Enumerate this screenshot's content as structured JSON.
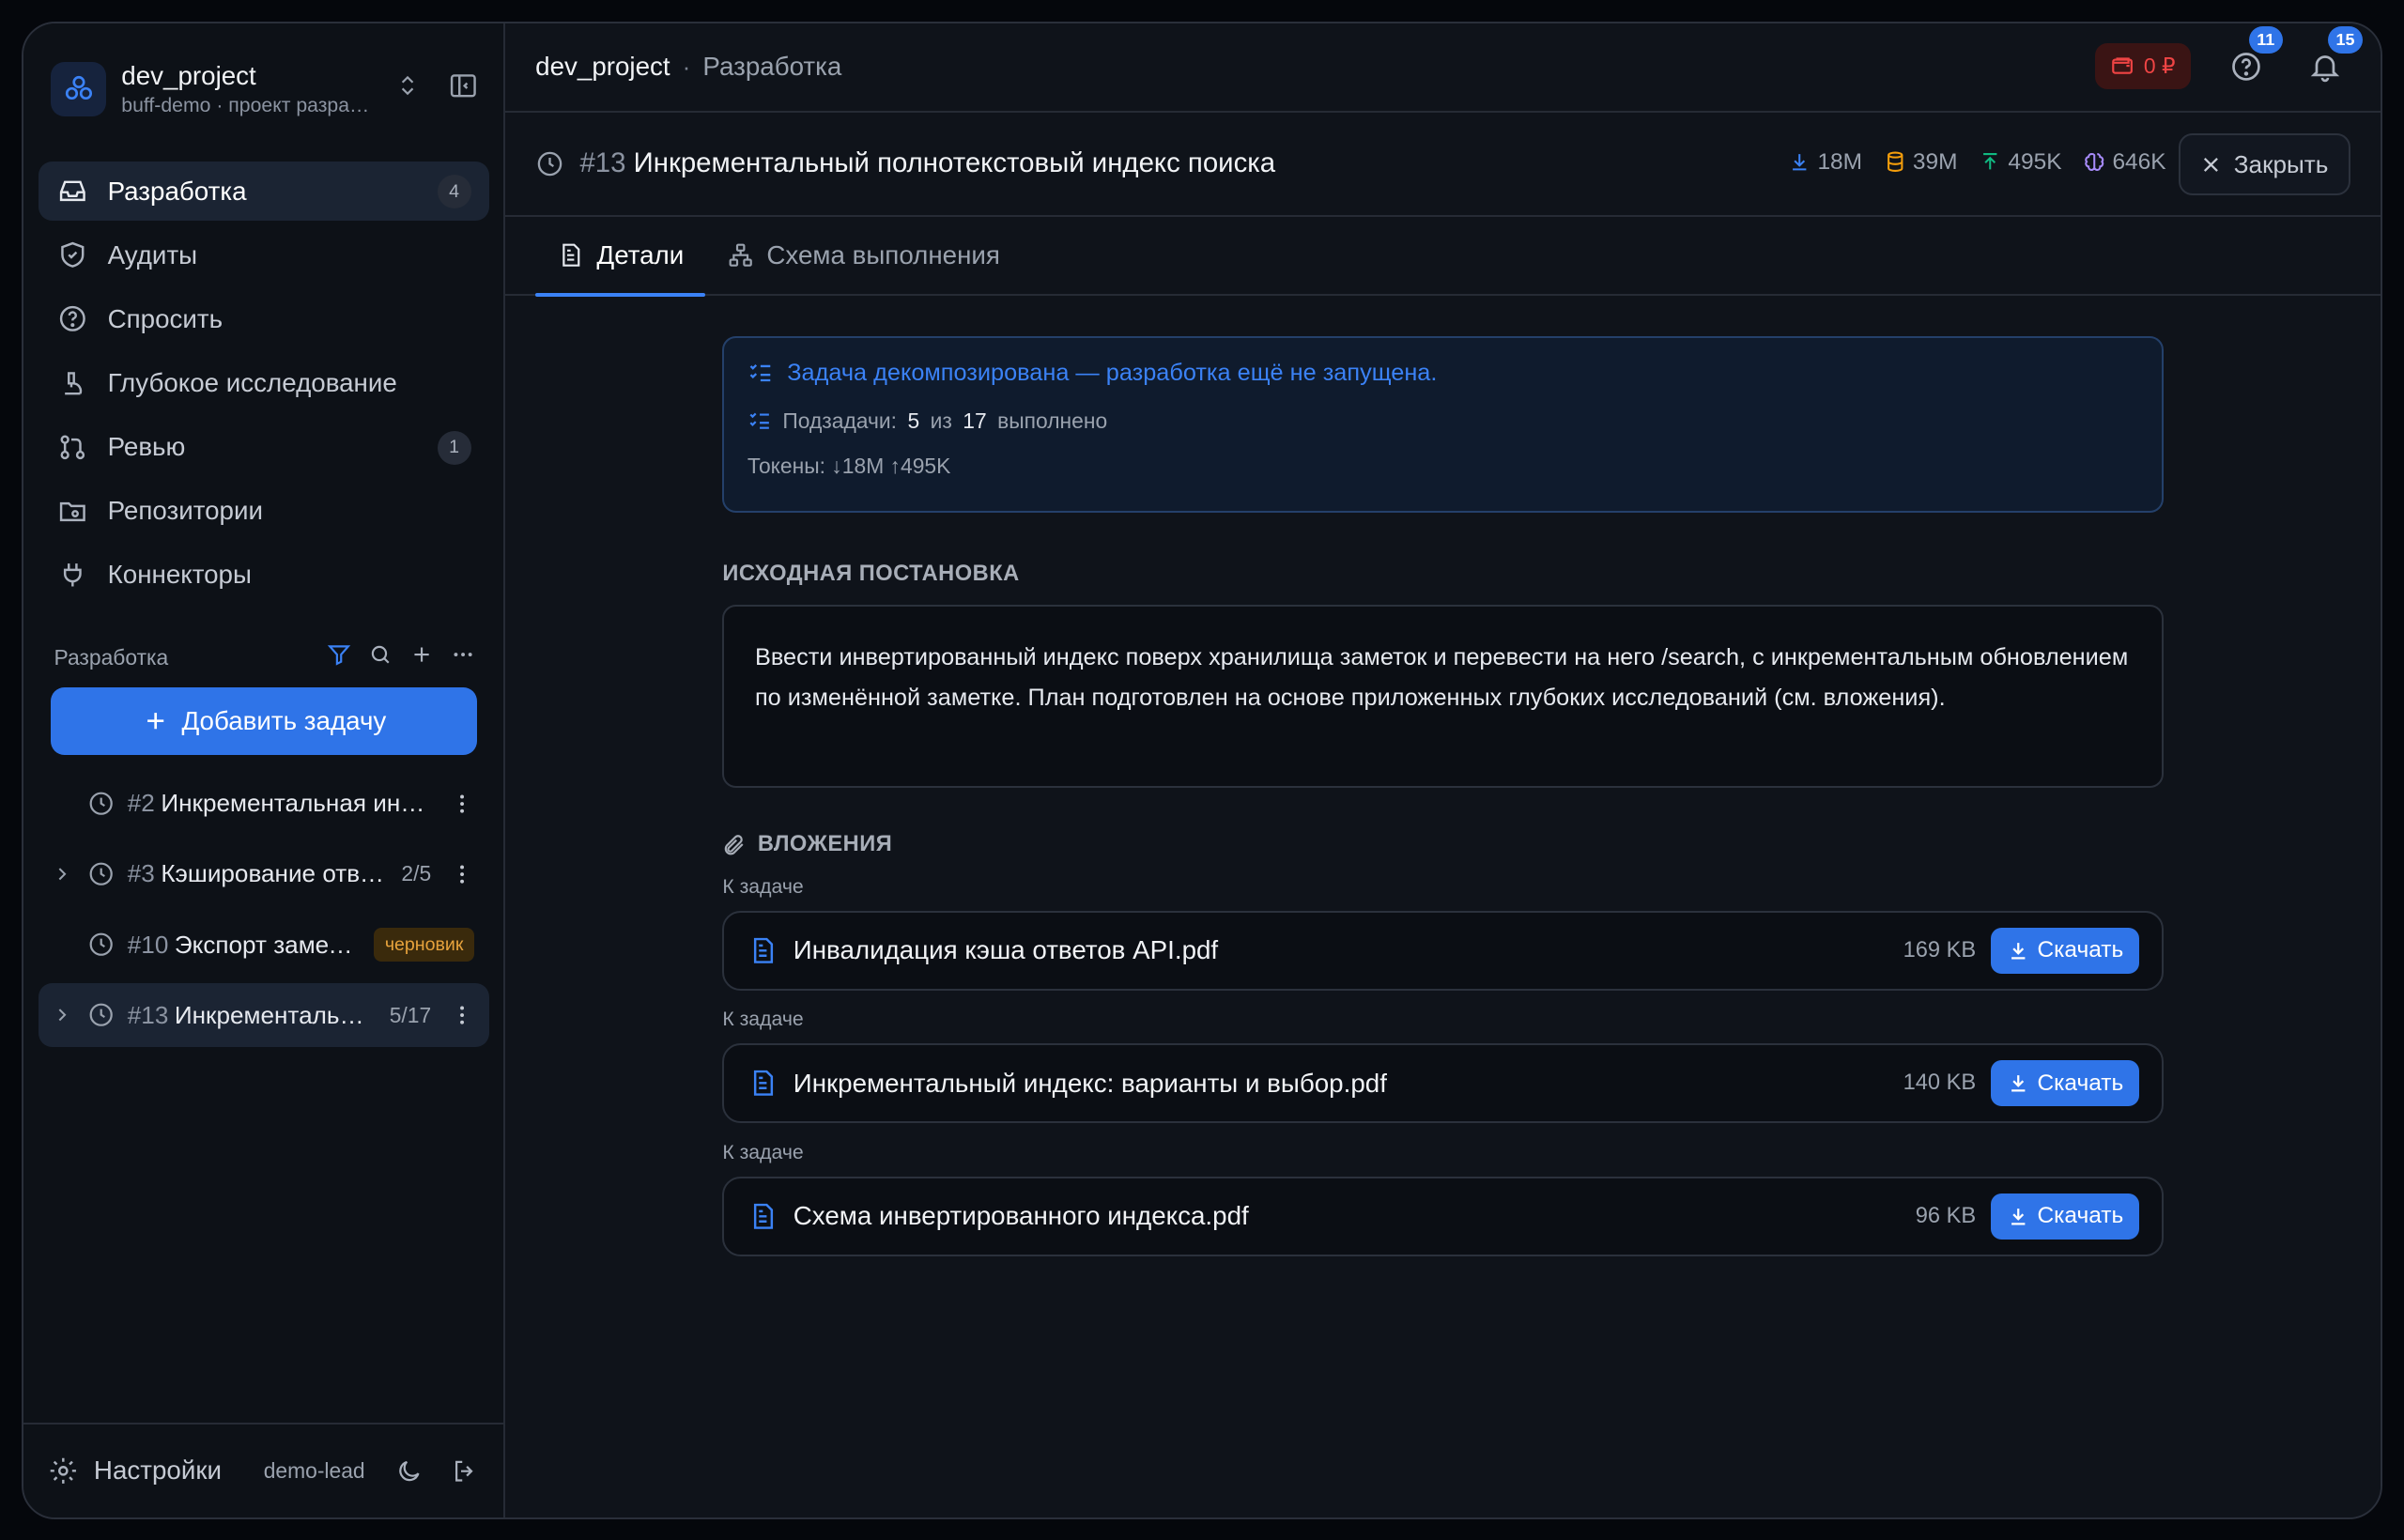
{
  "sidebar": {
    "project_name": "dev_project",
    "project_sub": "buff-demo · проект разработки",
    "nav": [
      {
        "label": "Разработка",
        "count": "4"
      },
      {
        "label": "Аудиты"
      },
      {
        "label": "Спросить"
      },
      {
        "label": "Глубокое исследование"
      },
      {
        "label": "Ревью",
        "count": "1"
      },
      {
        "label": "Репозитории"
      },
      {
        "label": "Коннекторы"
      }
    ],
    "section_title": "Разработка",
    "add_task": "Добавить задачу",
    "tasks": [
      {
        "num": "#2",
        "title": "Инкрементальная индексация"
      },
      {
        "num": "#3",
        "title": "Кэширование ответов API",
        "progress": "2/5"
      },
      {
        "num": "#10",
        "title": "Экспорт заметок",
        "badge": "черновик"
      },
      {
        "num": "#13",
        "title": "Инкрементальный полнотекстовый индекс поиска",
        "progress": "5/17"
      }
    ],
    "footer": {
      "settings": "Настройки",
      "user": "demo-lead"
    }
  },
  "topbar": {
    "crumb_project": "dev_project",
    "crumb_sep": "·",
    "crumb_section": "Разработка",
    "wallet": "0 ₽",
    "help_badge": "11",
    "notif_badge": "15"
  },
  "task": {
    "num": "#13",
    "title": "Инкрементальный полнотекстовый индекс поиска",
    "stats": {
      "down": "18M",
      "db": "39M",
      "up": "495K",
      "brain": "646K"
    },
    "close": "Закрыть"
  },
  "tabs": [
    {
      "label": "Детали"
    },
    {
      "label": "Схема выполнения"
    }
  ],
  "info": {
    "line1": "Задача декомпозирована — разработка ещё не запущена.",
    "subtasks_prefix": "Подзадачи:",
    "subtasks_done": "5",
    "subtasks_of": "из",
    "subtasks_total": "17",
    "subtasks_suffix": "выполнено",
    "tokens": "Токены: ↓18M ↑495K"
  },
  "original": {
    "title": "ИСХОДНАЯ ПОСТАНОВКА",
    "text": "Ввести инвертированный индекс поверх хранилища заметок и перевести на него /search, с инкрементальным обновлением по изменённой заметке. План подготовлен на основе приложенных глубоких исследований (см. вложения)."
  },
  "attachments": {
    "title": "ВЛОЖЕНИЯ",
    "download": "Скачать",
    "items": [
      {
        "label": "К задаче",
        "name": "Инвалидация кэша ответов API.pdf",
        "size": "169 KB"
      },
      {
        "label": "К задаче",
        "name": "Инкрементальный индекс: варианты и выбор.pdf",
        "size": "140 KB"
      },
      {
        "label": "К задаче",
        "name": "Схема инвертированного индекса.pdf",
        "size": "96 KB"
      }
    ]
  },
  "colors": {
    "accent": "#2f74e8",
    "background": "#0f131a",
    "sidebar": "#0d1117",
    "danger": "#ef4444",
    "draft": "#e6a23c"
  }
}
